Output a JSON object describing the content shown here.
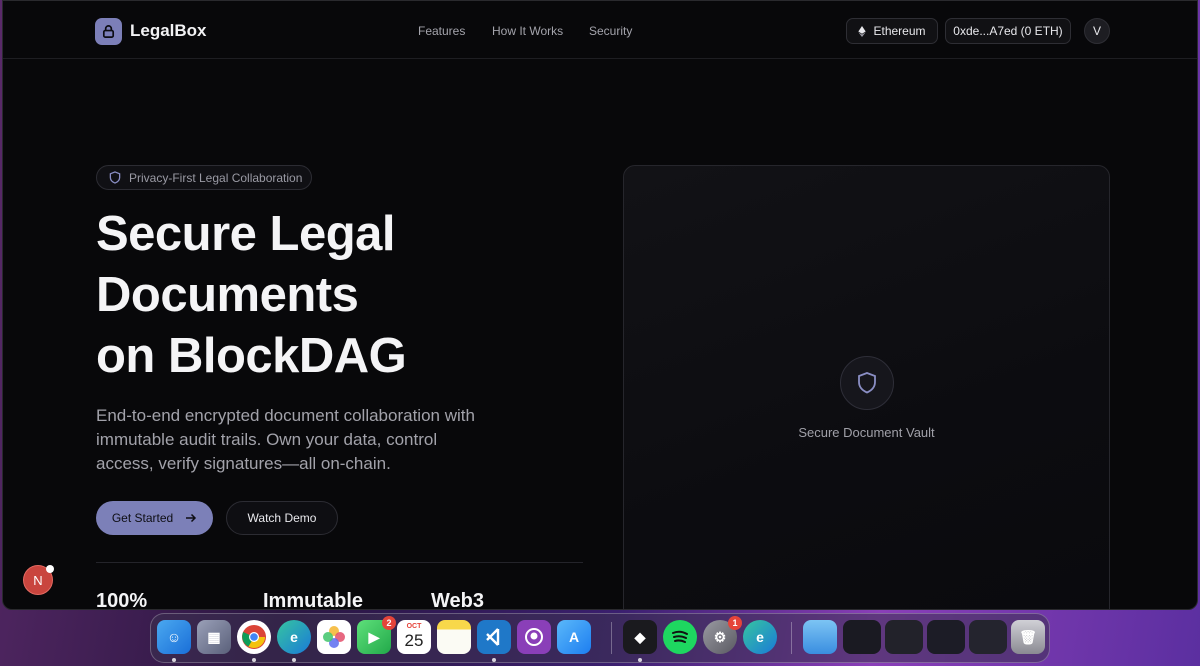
{
  "app": {
    "brand": "LegalBox"
  },
  "nav": {
    "links": [
      "Features",
      "How It Works",
      "Security"
    ],
    "network": "Ethereum",
    "wallet": "0xde...A7ed (0 ETH)",
    "avatar_initial": "V"
  },
  "hero": {
    "badge": "Privacy-First Legal Collaboration",
    "title_lines": [
      "Secure Legal",
      "Documents",
      "on BlockDAG"
    ],
    "description": "End-to-end encrypted document collaboration with immutable audit trails. Own your data, control access, verify signatures—all on-chain.",
    "primary_cta": "Get Started",
    "secondary_cta": "Watch Demo",
    "stats": [
      "100%",
      "Immutable",
      "Web3"
    ]
  },
  "vault": {
    "label": "Secure Document Vault"
  },
  "floating_badge": {
    "initial": "N"
  },
  "dock": {
    "calendar_month": "OCT",
    "calendar_day": "25",
    "facetime_badge": "2",
    "settings_badge": "1"
  },
  "colors": {
    "accent": "#7c80b8",
    "background": "#08080a"
  }
}
